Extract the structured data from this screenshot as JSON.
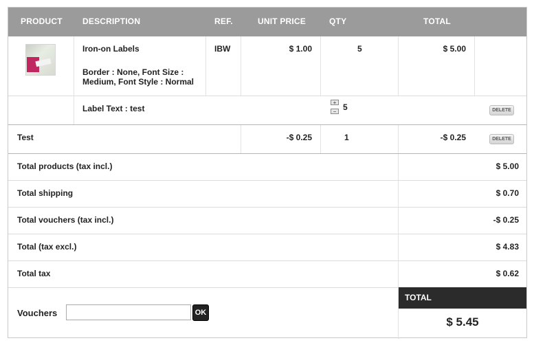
{
  "header": {
    "product": "PRODUCT",
    "description": "DESCRIPTION",
    "ref": "REF.",
    "unit_price": "UNIT PRICE",
    "qty": "QTY",
    "total": "TOTAL"
  },
  "item": {
    "name": "Iron-on Labels",
    "options_line1": "Border : None, Font Size :",
    "options_line2": "Medium, Font Style : Normal",
    "ref": "IBW",
    "unit_price": "$ 1.00",
    "qty": "5",
    "total": "$ 5.00",
    "customization_label": "Label Text : test",
    "customization_qty": "5",
    "qty_up": "+",
    "qty_down": "−",
    "delete_label": "DELETE"
  },
  "discount": {
    "name": "Test",
    "unit_price": "-$ 0.25",
    "qty": "1",
    "total": "-$ 0.25",
    "delete_label": "DELETE"
  },
  "summary": [
    {
      "label": "Total products (tax incl.)",
      "value": "$ 5.00"
    },
    {
      "label": "Total shipping",
      "value": "$ 0.70"
    },
    {
      "label": "Total vouchers (tax incl.)",
      "value": "-$ 0.25"
    },
    {
      "label": "Total (tax excl.)",
      "value": "$ 4.83"
    },
    {
      "label": "Total tax",
      "value": "$ 0.62"
    }
  ],
  "vouchers": {
    "label": "Vouchers",
    "input_value": "",
    "ok_label": "OK"
  },
  "grand_total": {
    "label": "TOTAL",
    "value": "$ 5.45"
  }
}
